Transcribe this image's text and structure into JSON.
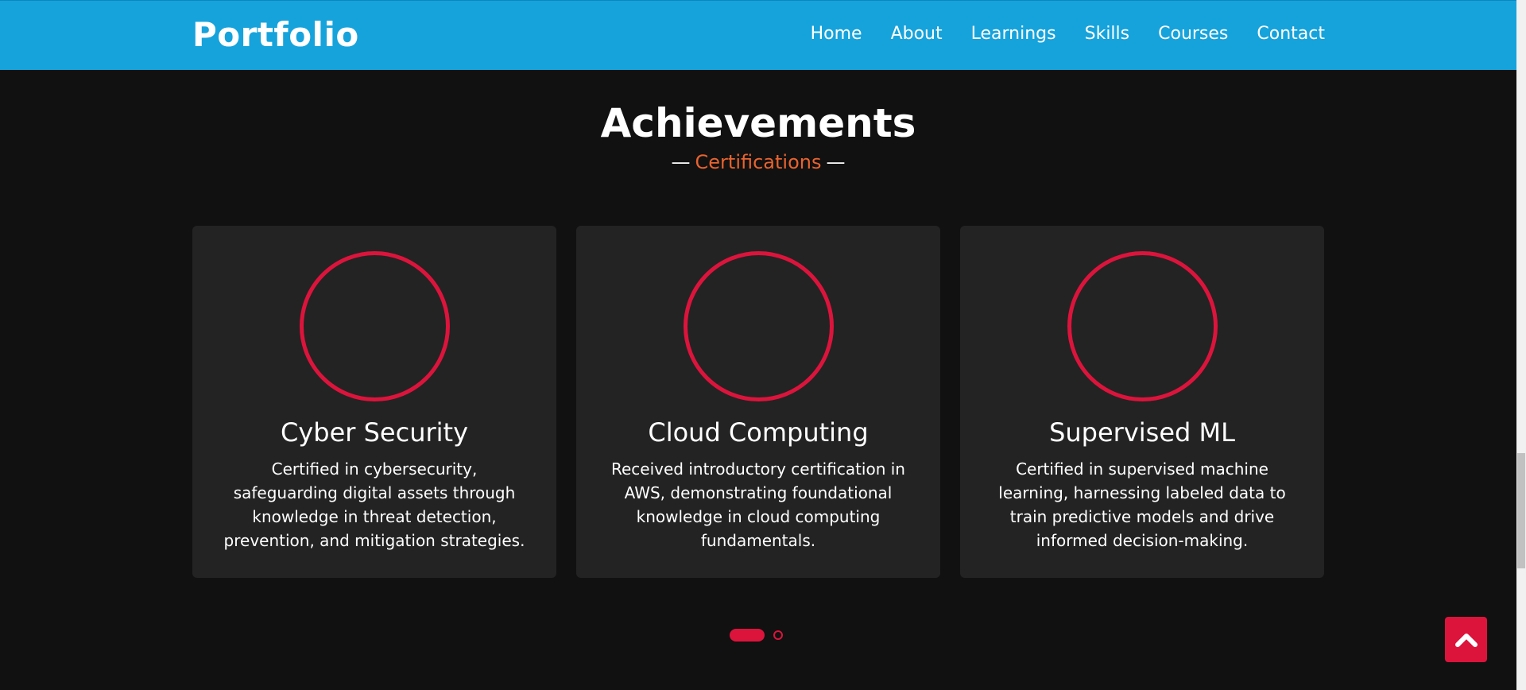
{
  "navbar": {
    "brand": "Portfolio",
    "items": [
      "Home",
      "About",
      "Learnings",
      "Skills",
      "Courses",
      "Contact"
    ],
    "color": "#16a3dc"
  },
  "section": {
    "title": "Achievements",
    "subtitle": "Certifications",
    "subtitle_color": "#e8632f"
  },
  "cards": [
    {
      "title": "Cyber Security",
      "description": "Certified in cybersecurity, safeguarding digital assets through knowledge in threat detection, prevention, and mitigation strategies."
    },
    {
      "title": "Cloud Computing",
      "description": "Received introductory certification in AWS, demonstrating foundational knowledge in cloud computing fundamentals."
    },
    {
      "title": "Supervised ML",
      "description": "Certified in supervised machine learning, harnessing labeled data to train predictive models and drive informed decision-making."
    }
  ],
  "carousel": {
    "pages": 2,
    "active_page": 1
  },
  "accent_color": "#dc143c",
  "scroll_top_icon": "chevron-up-icon"
}
